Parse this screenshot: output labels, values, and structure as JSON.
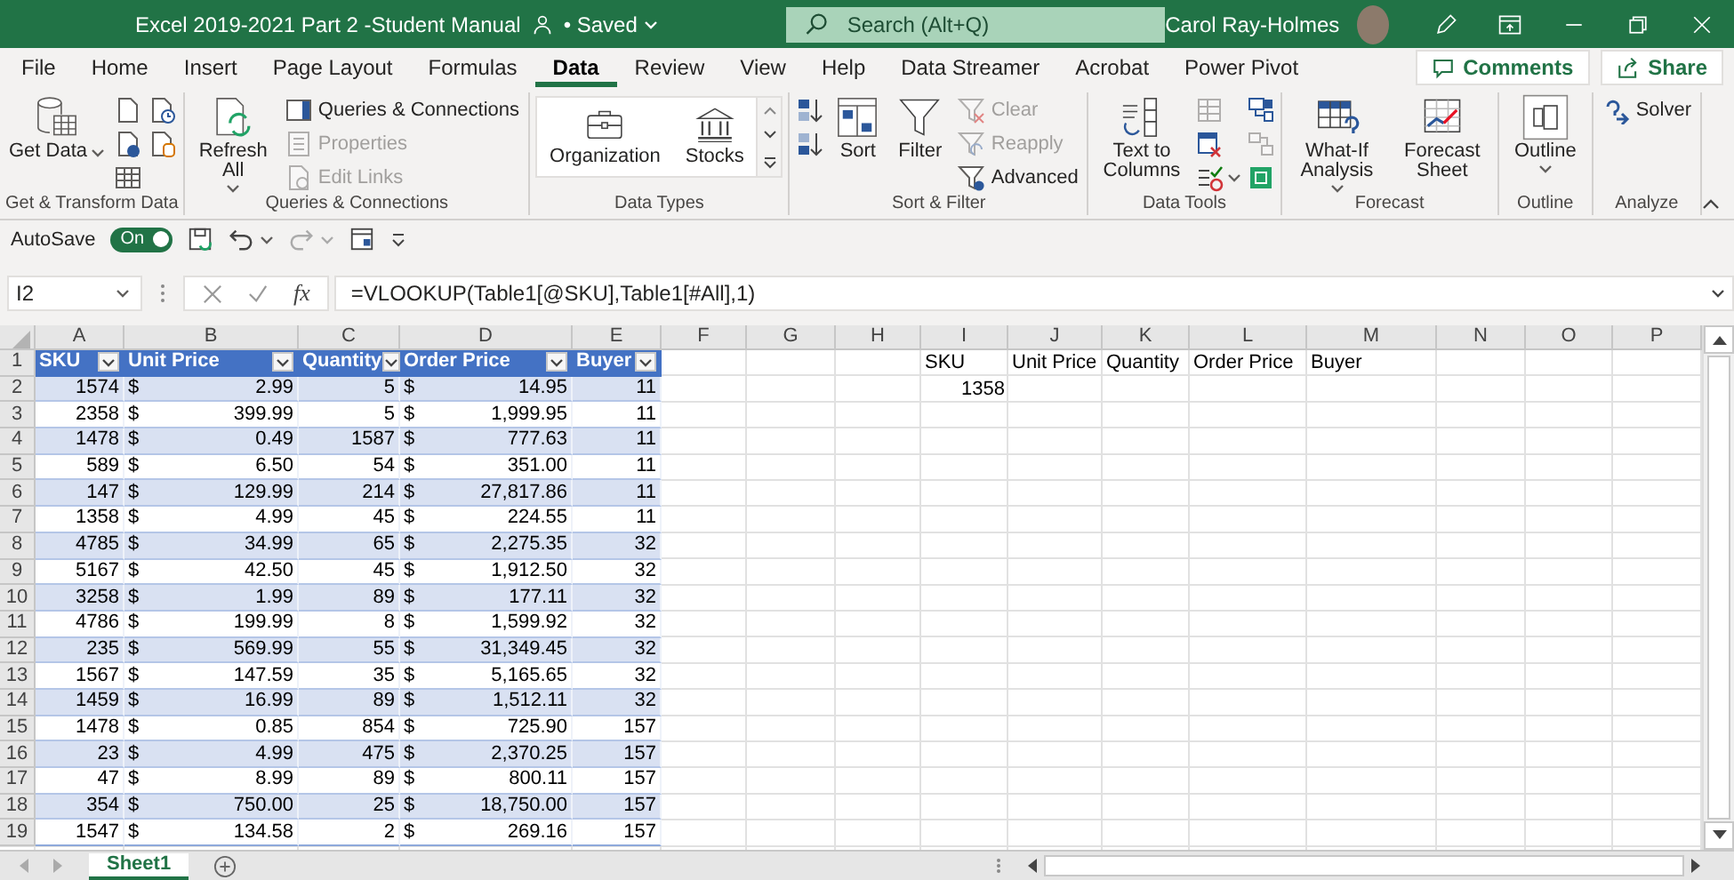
{
  "title_bar": {
    "document_title": "Excel 2019-2021 Part 2 -Student Manual",
    "saved_status": "• Saved",
    "search": {
      "placeholder": "Search (Alt+Q)"
    },
    "user_name": "Carol Ray-Holmes"
  },
  "menu_tabs": [
    {
      "label": "File",
      "selected": false
    },
    {
      "label": "Home",
      "selected": false
    },
    {
      "label": "Insert",
      "selected": false
    },
    {
      "label": "Page Layout",
      "selected": false
    },
    {
      "label": "Formulas",
      "selected": false
    },
    {
      "label": "Data",
      "selected": true
    },
    {
      "label": "Review",
      "selected": false
    },
    {
      "label": "View",
      "selected": false
    },
    {
      "label": "Help",
      "selected": false
    },
    {
      "label": "Data Streamer",
      "selected": false
    },
    {
      "label": "Acrobat",
      "selected": false
    },
    {
      "label": "Power Pivot",
      "selected": false
    }
  ],
  "header_buttons": [
    {
      "label": "Comments"
    },
    {
      "label": "Share"
    }
  ],
  "ribbon_groups": [
    {
      "label": "Get & Transform Data",
      "items": [
        {
          "kind": "large",
          "label": "Get Data",
          "dropdown": true,
          "disabled": false
        },
        {
          "kind": "icon",
          "dropdown": false,
          "disabled": false
        },
        {
          "kind": "icon",
          "dropdown": false,
          "disabled": false
        },
        {
          "kind": "icon",
          "dropdown": false,
          "disabled": false
        },
        {
          "kind": "icon",
          "dropdown": false,
          "disabled": false
        },
        {
          "kind": "icon",
          "dropdown": false,
          "disabled": false
        }
      ]
    },
    {
      "label": "Queries & Connections",
      "items": [
        {
          "kind": "large",
          "label": "Refresh All",
          "dropdown": true,
          "disabled": false
        },
        {
          "kind": "small",
          "label": "Queries & Connections",
          "dropdown": false,
          "disabled": false
        },
        {
          "kind": "small",
          "label": "Properties",
          "dropdown": false,
          "disabled": true
        },
        {
          "kind": "small",
          "label": "Edit Links",
          "dropdown": false,
          "disabled": true
        }
      ]
    },
    {
      "label": "Data Types",
      "items": [
        {
          "kind": "gallery",
          "label": "Organization",
          "dropdown": false,
          "disabled": false
        },
        {
          "kind": "gallery",
          "label": "Stocks",
          "dropdown": false,
          "disabled": false
        }
      ]
    },
    {
      "label": "Sort & Filter",
      "items": [
        {
          "kind": "icon",
          "dropdown": false,
          "disabled": false
        },
        {
          "kind": "icon",
          "dropdown": false,
          "disabled": false
        },
        {
          "kind": "large",
          "label": "Sort",
          "dropdown": false,
          "disabled": false
        },
        {
          "kind": "large",
          "label": "Filter",
          "dropdown": false,
          "disabled": false
        },
        {
          "kind": "small",
          "label": "Clear",
          "dropdown": false,
          "disabled": true
        },
        {
          "kind": "small",
          "label": "Reapply",
          "dropdown": false,
          "disabled": true
        },
        {
          "kind": "small",
          "label": "Advanced",
          "dropdown": false,
          "disabled": false
        }
      ]
    },
    {
      "label": "Data Tools",
      "items": [
        {
          "kind": "large",
          "label": "Text to Columns",
          "dropdown": false,
          "disabled": false
        },
        {
          "kind": "icon",
          "dropdown": false,
          "disabled": true
        },
        {
          "kind": "icon",
          "dropdown": false,
          "disabled": false
        },
        {
          "kind": "icon",
          "dropdown": true,
          "disabled": false
        },
        {
          "kind": "icon",
          "dropdown": false,
          "disabled": false
        },
        {
          "kind": "icon",
          "dropdown": false,
          "disabled": true
        },
        {
          "kind": "icon",
          "dropdown": false,
          "disabled": false
        }
      ]
    },
    {
      "label": "Forecast",
      "items": [
        {
          "kind": "large",
          "label": "What-If Analysis",
          "dropdown": true,
          "disabled": false
        },
        {
          "kind": "large",
          "label": "Forecast Sheet",
          "dropdown": false,
          "disabled": false
        }
      ]
    },
    {
      "label": "Outline",
      "items": [
        {
          "kind": "large",
          "label": "Outline",
          "dropdown": true,
          "disabled": false
        }
      ]
    },
    {
      "label": "Analyze",
      "items": [
        {
          "kind": "small",
          "label": "Solver",
          "dropdown": false,
          "disabled": false
        }
      ]
    }
  ],
  "quick_access": {
    "autosave_label": "AutoSave",
    "autosave_toggle": {
      "label": "On",
      "on": true
    }
  },
  "formula_bar": {
    "name_box": "I2",
    "function_label": "fx",
    "formula": "=VLOOKUP(Table1[@SKU],Table1[#All],1)"
  },
  "sheet": {
    "columns": [
      "A",
      "B",
      "C",
      "D",
      "E",
      "F",
      "G",
      "H",
      "I",
      "J",
      "K",
      "L",
      "M",
      "N",
      "O",
      "P"
    ],
    "rows": [
      "1",
      "2",
      "3",
      "4",
      "5",
      "6",
      "7",
      "8",
      "9",
      "10",
      "11",
      "12",
      "13",
      "14",
      "15",
      "16",
      "17",
      "18",
      "19"
    ],
    "table": {
      "columns": [
        "SKU",
        "Unit Price",
        "Quantity",
        "Order Price",
        "Buyer"
      ],
      "rows": [
        {
          "sku": "1574",
          "unit_currency": "$",
          "unit_price": "2.99",
          "quantity": "5",
          "order_currency": "$",
          "order_price": "14.95",
          "buyer": "11"
        },
        {
          "sku": "2358",
          "unit_currency": "$",
          "unit_price": "399.99",
          "quantity": "5",
          "order_currency": "$",
          "order_price": "1,999.95",
          "buyer": "11"
        },
        {
          "sku": "1478",
          "unit_currency": "$",
          "unit_price": "0.49",
          "quantity": "1587",
          "order_currency": "$",
          "order_price": "777.63",
          "buyer": "11"
        },
        {
          "sku": "589",
          "unit_currency": "$",
          "unit_price": "6.50",
          "quantity": "54",
          "order_currency": "$",
          "order_price": "351.00",
          "buyer": "11"
        },
        {
          "sku": "147",
          "unit_currency": "$",
          "unit_price": "129.99",
          "quantity": "214",
          "order_currency": "$",
          "order_price": "27,817.86",
          "buyer": "11"
        },
        {
          "sku": "1358",
          "unit_currency": "$",
          "unit_price": "4.99",
          "quantity": "45",
          "order_currency": "$",
          "order_price": "224.55",
          "buyer": "11"
        },
        {
          "sku": "4785",
          "unit_currency": "$",
          "unit_price": "34.99",
          "quantity": "65",
          "order_currency": "$",
          "order_price": "2,275.35",
          "buyer": "32"
        },
        {
          "sku": "5167",
          "unit_currency": "$",
          "unit_price": "42.50",
          "quantity": "45",
          "order_currency": "$",
          "order_price": "1,912.50",
          "buyer": "32"
        },
        {
          "sku": "3258",
          "unit_currency": "$",
          "unit_price": "1.99",
          "quantity": "89",
          "order_currency": "$",
          "order_price": "177.11",
          "buyer": "32"
        },
        {
          "sku": "4786",
          "unit_currency": "$",
          "unit_price": "199.99",
          "quantity": "8",
          "order_currency": "$",
          "order_price": "1,599.92",
          "buyer": "32"
        },
        {
          "sku": "235",
          "unit_currency": "$",
          "unit_price": "569.99",
          "quantity": "55",
          "order_currency": "$",
          "order_price": "31,349.45",
          "buyer": "32"
        },
        {
          "sku": "1567",
          "unit_currency": "$",
          "unit_price": "147.59",
          "quantity": "35",
          "order_currency": "$",
          "order_price": "5,165.65",
          "buyer": "32"
        },
        {
          "sku": "1459",
          "unit_currency": "$",
          "unit_price": "16.99",
          "quantity": "89",
          "order_currency": "$",
          "order_price": "1,512.11",
          "buyer": "32"
        },
        {
          "sku": "1478",
          "unit_currency": "$",
          "unit_price": "0.85",
          "quantity": "854",
          "order_currency": "$",
          "order_price": "725.90",
          "buyer": "157"
        },
        {
          "sku": "23",
          "unit_currency": "$",
          "unit_price": "4.99",
          "quantity": "475",
          "order_currency": "$",
          "order_price": "2,370.25",
          "buyer": "157"
        },
        {
          "sku": "47",
          "unit_currency": "$",
          "unit_price": "8.99",
          "quantity": "89",
          "order_currency": "$",
          "order_price": "800.11",
          "buyer": "157"
        },
        {
          "sku": "354",
          "unit_currency": "$",
          "unit_price": "750.00",
          "quantity": "25",
          "order_currency": "$",
          "order_price": "18,750.00",
          "buyer": "157"
        },
        {
          "sku": "1547",
          "unit_currency": "$",
          "unit_price": "134.58",
          "quantity": "2",
          "order_currency": "$",
          "order_price": "269.16",
          "buyer": "157"
        }
      ]
    },
    "lookup": {
      "headers": [
        "SKU",
        "Unit Price",
        "Quantity",
        "Order Price",
        "Buyer"
      ],
      "values": [
        "1358"
      ]
    }
  },
  "sheet_tabs": [
    {
      "label": "Sheet1",
      "selected": true
    }
  ]
}
